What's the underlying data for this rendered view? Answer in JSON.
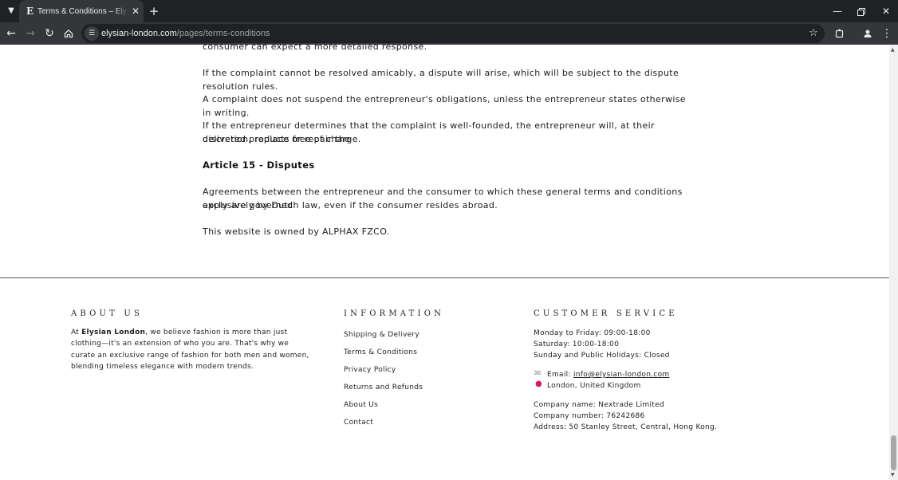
{
  "browser": {
    "tab_title": "Terms & Conditions – Elysian London",
    "favicon_letter": "E",
    "url_host": "elysian-london.com",
    "url_path": "/pages/terms-conditions"
  },
  "article": {
    "cutoff_line": "consumer can expect a more detailed response.",
    "p1": "If the complaint cannot be resolved amicably, a dispute will arise, which will be subject to the dispute resolution rules.",
    "p2": "A complaint does not suspend the entrepreneur's obligations, unless the entrepreneur states otherwise in writing.",
    "p3_line1": "If the entrepreneur determines that the complaint is well-founded, the entrepreneur will, at their discretion, replace or repair the",
    "p3_line2": "delivered products free of charge.",
    "heading": "Article 15 - Disputes",
    "p4_line1": "Agreements between the entrepreneur and the consumer to which these general terms and conditions apply are governed",
    "p4_line2": "exclusively by Dutch law, even if the consumer resides abroad.",
    "owner": "This website is owned by ALPHAX FZCO."
  },
  "footer": {
    "about": {
      "heading": "ABOUT US",
      "prefix": "At ",
      "brand": "Elysian London",
      "body": ", we believe fashion is more than just clothing—it's an extension of who you are. That's why we curate an exclusive range of fashion for both men and women, blending timeless elegance with modern trends."
    },
    "information": {
      "heading": "INFORMATION",
      "links": [
        "Shipping & Delivery",
        "Terms & Conditions",
        "Privacy Policy",
        "Returns and Refunds",
        "About Us",
        "Contact"
      ]
    },
    "customer_service": {
      "heading": "CUSTOMER SERVICE",
      "hours": [
        "Monday to Friday: 09:00-18:00",
        "Saturday: 10:00-18:00",
        "Sunday and Public Holidays: Closed"
      ],
      "email_label": "Email: ",
      "email": "info@elysian-london.com",
      "location": "London, United Kingdom",
      "company_name": "Company name: Nextrade Limited",
      "company_number": "Company number: 76242686",
      "address": "Address: 50 Stanley Street, Central, Hong Kong."
    }
  }
}
